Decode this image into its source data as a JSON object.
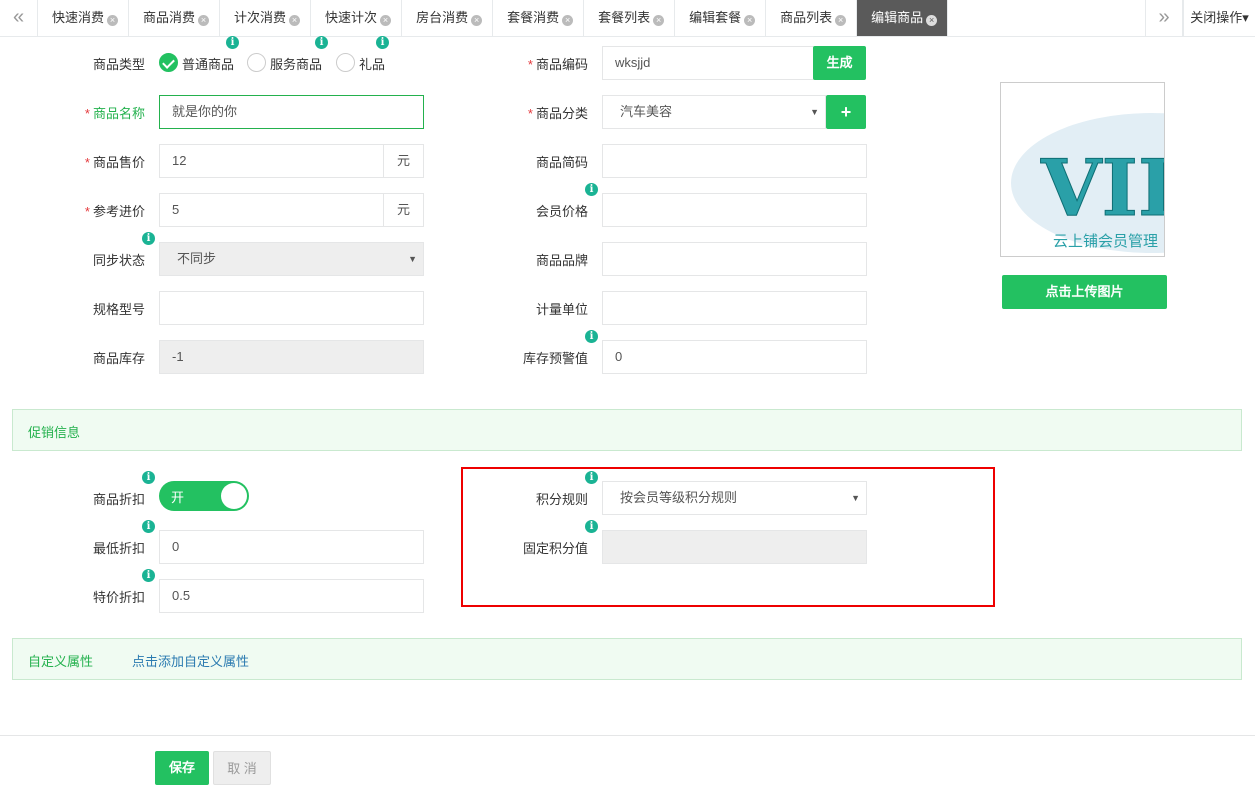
{
  "tabs": [
    {
      "label": "快速消费",
      "active": false
    },
    {
      "label": "商品消费",
      "active": false
    },
    {
      "label": "计次消费",
      "active": false
    },
    {
      "label": "快速计次",
      "active": false
    },
    {
      "label": "房台消费",
      "active": false
    },
    {
      "label": "套餐消费",
      "active": false
    },
    {
      "label": "套餐列表",
      "active": false
    },
    {
      "label": "编辑套餐",
      "active": false
    },
    {
      "label": "商品列表",
      "active": false
    },
    {
      "label": "编辑商品",
      "active": true
    }
  ],
  "tab_nav": {
    "left": "«",
    "right": "»",
    "close_ops": "关闭操作▾"
  },
  "form": {
    "product_type": {
      "label": "商品类型",
      "options": [
        "普通商品",
        "服务商品",
        "礼品"
      ],
      "selected": "普通商品"
    },
    "product_name": {
      "label": "商品名称",
      "value": "就是你的你"
    },
    "sale_price": {
      "label": "商品售价",
      "value": "12",
      "unit": "元"
    },
    "cost_price": {
      "label": "参考进价",
      "value": "5",
      "unit": "元"
    },
    "sync_status": {
      "label": "同步状态",
      "value": "不同步"
    },
    "spec_model": {
      "label": "规格型号",
      "value": ""
    },
    "stock": {
      "label": "商品库存",
      "value": "-1"
    },
    "product_code": {
      "label": "商品编码",
      "value": "wksjjd",
      "button": "生成"
    },
    "category": {
      "label": "商品分类",
      "value": "汽车美容",
      "button": "+"
    },
    "short_code": {
      "label": "商品简码",
      "value": ""
    },
    "member_price": {
      "label": "会员价格",
      "value": ""
    },
    "brand": {
      "label": "商品品牌",
      "value": ""
    },
    "unit": {
      "label": "计量单位",
      "value": ""
    },
    "stock_alert": {
      "label": "库存预警值",
      "value": "0"
    }
  },
  "image": {
    "logo_text": "VII",
    "caption": "云上铺会员管理",
    "upload_button": "点击上传图片"
  },
  "promo": {
    "title": "促销信息",
    "discount": {
      "label": "商品折扣",
      "toggle_text": "开",
      "on": true
    },
    "min_discount": {
      "label": "最低折扣",
      "value": "0"
    },
    "special_discount": {
      "label": "特价折扣",
      "value": "0.5"
    },
    "points_rule": {
      "label": "积分规则",
      "value": "按会员等级积分规则"
    },
    "fixed_points": {
      "label": "固定积分值",
      "value": ""
    }
  },
  "custom": {
    "title": "自定义属性",
    "link": "点击添加自定义属性"
  },
  "actions": {
    "save": "保存",
    "cancel": "取 消"
  },
  "colors": {
    "accent": "#23c161",
    "required": "#e4393c",
    "highlight": "#ee0000"
  }
}
